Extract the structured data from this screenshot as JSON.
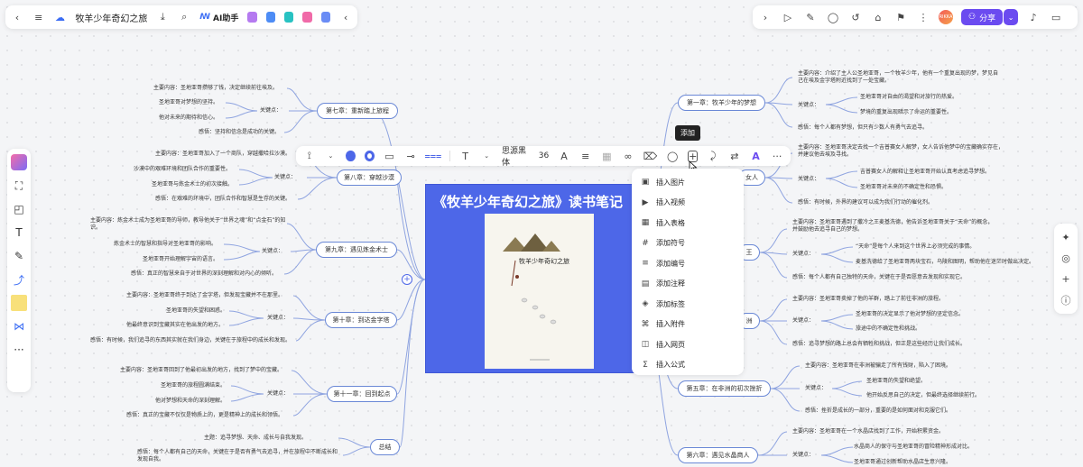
{
  "topbar": {
    "doc_title": "牧羊少年奇幻之旅",
    "ai_label": "AI助手"
  },
  "rightbar": {
    "share_label": "分享",
    "avatar_label": "RIKKA"
  },
  "tooltip": "添加",
  "format_toolbar": {
    "font_name": "思源黑体",
    "font_size": "36"
  },
  "insert_menu": {
    "items": [
      {
        "label": "插入图片",
        "icon": "image-icon",
        "glyph": "▣"
      },
      {
        "label": "插入视频",
        "icon": "video-icon",
        "glyph": "▶"
      },
      {
        "label": "插入表格",
        "icon": "table-icon",
        "glyph": "▦"
      },
      {
        "label": "添加符号",
        "icon": "symbol-icon",
        "glyph": "#"
      },
      {
        "label": "添加编号",
        "icon": "numbering-icon",
        "glyph": "≡"
      },
      {
        "label": "添加注释",
        "icon": "note-icon",
        "glyph": "▤"
      },
      {
        "label": "添加标签",
        "icon": "tag-icon",
        "glyph": "◈"
      },
      {
        "label": "插入附件",
        "icon": "attachment-icon",
        "glyph": "⌘"
      },
      {
        "label": "插入网页",
        "icon": "webpage-icon",
        "glyph": "◫"
      },
      {
        "label": "插入公式",
        "icon": "formula-icon",
        "glyph": "Σ"
      }
    ]
  },
  "center_node": {
    "title": "《牧羊少年奇幻之旅》读书笔记",
    "book_title": "牧羊少年奇幻之旅"
  },
  "left_branches": {
    "ch7": {
      "label": "第七章：重新踏上旅程",
      "content": "主要内容：圣地亚哥攒够了钱，决定继续前往埃及。",
      "key": "关键点：",
      "k1": "圣地亚哥对梦想的坚持。",
      "k2": "他对未来的期待和信心。",
      "feel": "感悟：坚持和信念是成功的关键。"
    },
    "ch8": {
      "label": "第八章：穿越沙漠",
      "content": "主要内容：圣地亚哥加入了一个商队，穿越撒哈拉沙漠。",
      "key": "关键点：",
      "k1": "沙漠中的艰难环境和团队合作的重要性。",
      "k2": "圣地亚哥与炼金术士的初次接触。",
      "feel": "感悟：在艰难的环境中，团队合作和智慧是生存的关键。"
    },
    "ch9": {
      "label": "第九章：遇见炼金术士",
      "content": "主要内容：炼金术士成为圣地亚哥的导师，教导他关于“世界之魂”和“点金石”的知识。",
      "key": "关键点：",
      "k1": "炼金术士的智慧和指导对圣地亚哥的影响。",
      "k2": "圣地亚哥开始理解宇宙的语言。",
      "feel": "感悟：真正的智慧来自于对世界的深刻理解和对内心的倾听。"
    },
    "ch10": {
      "label": "第十章：到达金字塔",
      "content": "主要内容：圣地亚哥终于到达了金字塔，但发现宝藏并不在那里。",
      "key": "关键点：",
      "k1": "圣地亚哥的失望和困惑。",
      "k2": "他最终意识到宝藏其实在他出发的地方。",
      "feel": "感悟：有时候，我们追寻的东西其实就在我们身边，关键在于旅程中的成长和发现。"
    },
    "ch11": {
      "label": "第十一章：回到起点",
      "content": "主要内容：圣地亚哥回到了他最初出发的地方，找到了梦中的宝藏。",
      "key": "关键点：",
      "k1": "圣地亚哥的旅程圆满结束。",
      "k2": "他对梦想和天命的深刻理解。",
      "feel": "感悟：真正的宝藏不仅仅是物质上的，更是精神上的成长和领悟。"
    },
    "summary": {
      "label": "总结",
      "theme": "主题：追寻梦想、天命、成长与自我发现。",
      "feel": "感悟：每个人都有自己的天命，关键在于是否有勇气去追寻，并在旅程中不断成长和发现自我。"
    }
  },
  "right_branches": {
    "ch1": {
      "label": "第一章：牧羊少年的梦想",
      "content": "主要内容：介绍了主人公圣地亚哥，一个牧羊少年，他有一个重复出现的梦，梦见自己在埃及金字塔附近找到了一处宝藏。",
      "key": "关键点：",
      "k1": "圣地亚哥对自由的渴望和对旅行的热爱。",
      "k2": "梦境的重复出现暗示了命运的重要性。",
      "feel": "感悟：每个人都有梦想，但只有少数人有勇气去追寻。"
    },
    "ch2": {
      "label_visible": "女人",
      "content": "主要内容：圣地亚哥决定去找一个吉普赛女人解梦，女人告诉他梦中的宝藏确实存在，并建议他去埃及寻找。",
      "key": "关键点：",
      "k1": "吉普赛女人的解释让圣地亚哥开始认真考虑追寻梦想。",
      "k2": "圣地亚哥对未来的不确定性和恐惧。",
      "feel": "感悟：有时候，外界的建议可以成为我们行动的催化剂。"
    },
    "ch3": {
      "label_visible": "王",
      "content": "主要内容：圣地亚哥遇到了撒冷之王麦基洗德，他告诉圣地亚哥关于“天命”的概念，并鼓励他去追寻自己的梦想。",
      "key": "关键点：",
      "k1": "“天命”是每个人来到这个世界上必须完成的事情。",
      "k2": "麦基洗德给了圣地亚哥两块宝石，乌陵和图明，帮助他在迷茫时做出决定。",
      "feel": "感悟：每个人都有自己独特的天命，关键在于是否愿意去发现和实现它。"
    },
    "ch4": {
      "label_visible": "洲",
      "content": "主要内容：圣地亚哥卖掉了他的羊群，踏上了前往非洲的旅程。",
      "key": "关键点：",
      "k1": "圣地亚哥的决定显示了他对梦想的坚定信念。",
      "k2": "旅途中的不确定性和挑战。",
      "feel": "感悟：追寻梦想的路上总会有牺牲和挑战，但正是这些经历让我们成长。"
    },
    "ch5": {
      "label": "第五章：在非洲的初次挫折",
      "content": "主要内容：圣地亚哥在非洲被骗走了所有钱财，陷入了困境。",
      "key": "关键点：",
      "k1": "圣地亚哥的失望和绝望。",
      "k2": "他开始反思自己的决定，但最终选择继续前行。",
      "feel": "感悟：挫折是成长的一部分，重要的是如何面对和克服它们。"
    },
    "ch6": {
      "label": "第六章：遇见水晶商人",
      "content": "主要内容：圣地亚哥在一个水晶店找到了工作，开始积累资金。",
      "key": "关键点：",
      "k1": "水晶商人的保守与圣地亚哥的冒险精神形成对比。",
      "k2": "圣地亚哥通过创新帮助水晶店生意兴隆。"
    }
  }
}
